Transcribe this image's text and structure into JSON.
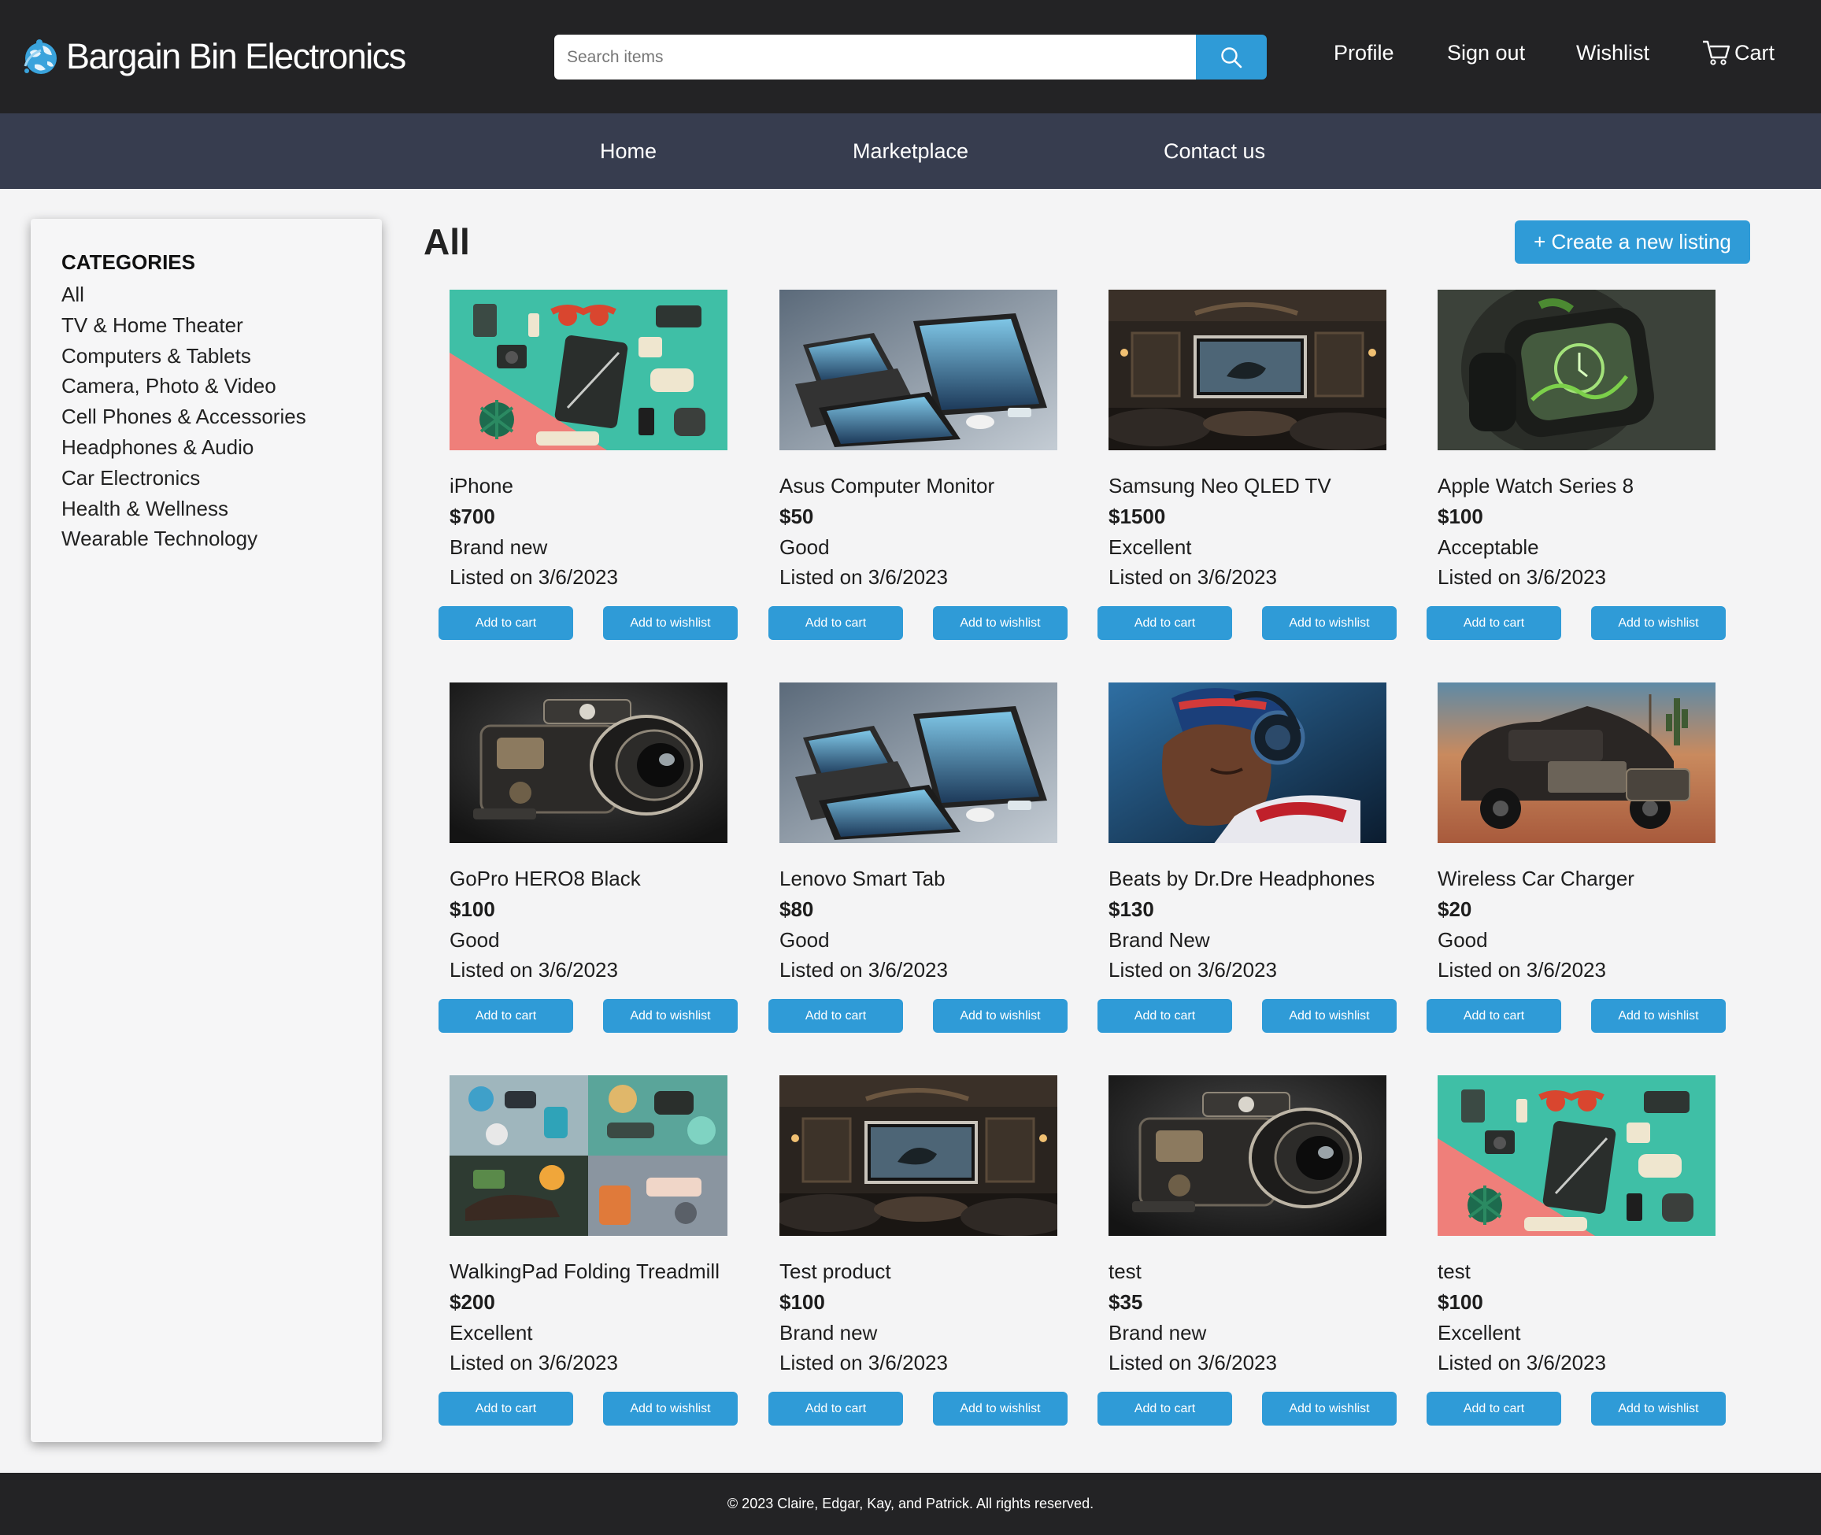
{
  "header": {
    "brand": "Bargain Bin Electronics",
    "search_placeholder": "Search items",
    "links": {
      "profile": "Profile",
      "sign_out": "Sign out",
      "wishlist": "Wishlist",
      "cart": "Cart"
    }
  },
  "nav": {
    "home": "Home",
    "marketplace": "Marketplace",
    "contact": "Contact us"
  },
  "sidebar": {
    "title": "CATEGORIES",
    "items": [
      "All",
      "TV & Home Theater",
      "Computers & Tablets",
      "Camera, Photo & Video",
      "Cell Phones & Accessories",
      "Headphones & Audio",
      "Car Electronics",
      "Health & Wellness",
      "Wearable Technology"
    ]
  },
  "main": {
    "title": "All",
    "create_label": "+ Create a new listing",
    "add_cart_label": "Add to cart",
    "add_wishlist_label": "Add to wishlist",
    "products": [
      {
        "name": "iPhone",
        "price": "$700",
        "condition": "Brand new",
        "listed": "Listed on 3/6/2023",
        "image": "flatlay-gadgets"
      },
      {
        "name": "Asus Computer Monitor",
        "price": "$50",
        "condition": "Good",
        "listed": "Listed on 3/6/2023",
        "image": "tablets-laptop"
      },
      {
        "name": "Samsung Neo QLED TV",
        "price": "$1500",
        "condition": "Excellent",
        "listed": "Listed on 3/6/2023",
        "image": "home-theater"
      },
      {
        "name": "Apple Watch Series 8",
        "price": "$100",
        "condition": "Acceptable",
        "listed": "Listed on 3/6/2023",
        "image": "smartwatch"
      },
      {
        "name": "GoPro HERO8 Black",
        "price": "$100",
        "condition": "Good",
        "listed": "Listed on 3/6/2023",
        "image": "vintage-camera"
      },
      {
        "name": "Lenovo Smart Tab",
        "price": "$80",
        "condition": "Good",
        "listed": "Listed on 3/6/2023",
        "image": "tablets-laptop"
      },
      {
        "name": "Beats by Dr.Dre Headphones",
        "price": "$130",
        "condition": "Brand New",
        "listed": "Listed on 3/6/2023",
        "image": "headphones-portrait"
      },
      {
        "name": "Wireless Car Charger",
        "price": "$20",
        "condition": "Good",
        "listed": "Listed on 3/6/2023",
        "image": "desert-car"
      },
      {
        "name": "WalkingPad Folding Treadmill",
        "price": "$200",
        "condition": "Excellent",
        "listed": "Listed on 3/6/2023",
        "image": "wellness-collage"
      },
      {
        "name": "Test product",
        "price": "$100",
        "condition": "Brand new",
        "listed": "Listed on 3/6/2023",
        "image": "home-theater"
      },
      {
        "name": "test",
        "price": "$35",
        "condition": "Brand new",
        "listed": "Listed on 3/6/2023",
        "image": "vintage-camera"
      },
      {
        "name": "test",
        "price": "$100",
        "condition": "Excellent",
        "listed": "Listed on 3/6/2023",
        "image": "flatlay-gadgets"
      }
    ]
  },
  "footer": {
    "text": "© 2023 Claire, Edgar, Kay, and Patrick. All rights reserved."
  },
  "colors": {
    "header_bg": "#232325",
    "nav_bg": "#373d4f",
    "accent": "#2f9bd7"
  }
}
